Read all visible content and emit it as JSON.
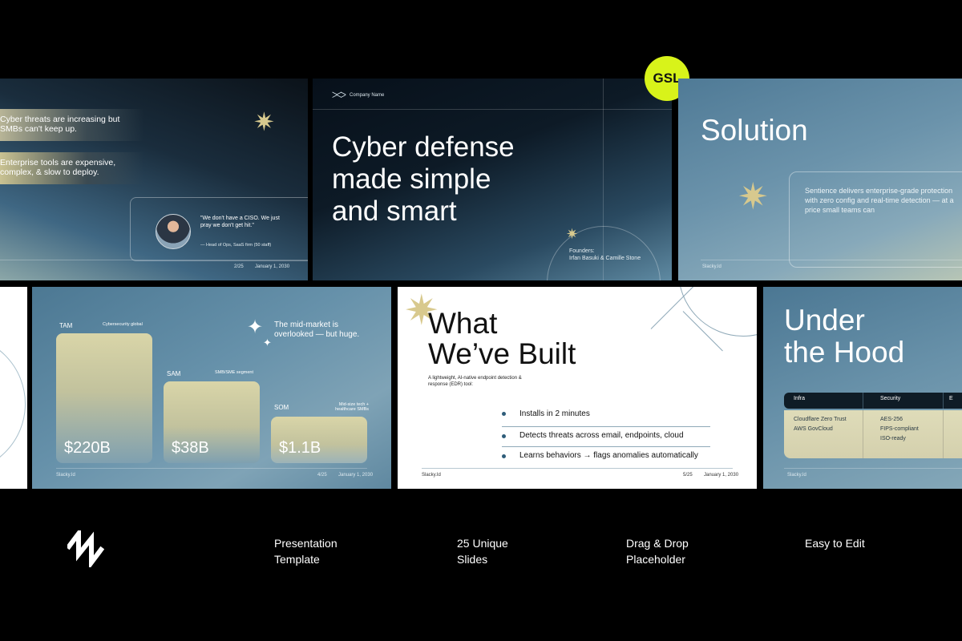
{
  "badge": "GSL",
  "slide1": {
    "problem1": "Cyber threats are increasing but SMBs can't keep up.",
    "problem2": "Enterprise tools are expensive, complex, & slow to deploy.",
    "quote": "\"We don't have a CISO. We just pray we don't get hit.\"",
    "quote_author": "— Head of Ops, SaaS firm (50 staff)",
    "page": "2/25",
    "date": "January 1, 2030"
  },
  "slide2": {
    "company": "Company Name",
    "title_l1": "Cyber defense",
    "title_l2": "made simple",
    "title_l3": "and smart",
    "founders_label": "Founders:",
    "founders": "Irfan Basuki & Camille Stone"
  },
  "slide3": {
    "title": "Solution",
    "body": "Sentience delivers enterprise-grade protection with zero config and real-time detection — at a price small teams can",
    "footer": "Slacky.Id"
  },
  "slide5": {
    "tam_label": "TAM",
    "tam_desc": "Cybersecurity global",
    "tam_value": "$220B",
    "sam_label": "SAM",
    "sam_desc": "SMB/SME segment",
    "sam_value": "$38B",
    "som_label": "SOM",
    "som_desc": "Mid-size tech + healthcare SMBs",
    "som_value": "$1.1B",
    "callout": "The mid-market is overlooked — but huge.",
    "footer": "Slacky.Id",
    "page": "4/25",
    "date": "January 1, 2030"
  },
  "slide6": {
    "title_l1": "What",
    "title_l2": "We’ve Built",
    "subtitle": "A lightweight, AI-native endpoint detection & response (EDR) tool:",
    "bullets": [
      "Installs in 2 minutes",
      "Detects threats across email, endpoints, cloud",
      "Learns behaviors → flags anomalies automatically"
    ],
    "footer": "Slacky.Id",
    "page": "5/25",
    "date": "January 1, 2030"
  },
  "slide7": {
    "title_l1": "Under",
    "title_l2": "the Hood",
    "col_infra": "Infra",
    "col_security": "Security",
    "col_e": "E",
    "infra1": "Cloudflare Zero Trust",
    "infra2": "AWS GovCloud",
    "sec1": "AES-256",
    "sec2": "FIPS-compliant",
    "sec3": "ISO-ready",
    "footer": "Slacky.Id"
  },
  "features": [
    "Presentation Template",
    "25 Unique Slides",
    "Drag & Drop Placeholder",
    "Easy to Edit"
  ],
  "feature_lines": [
    [
      "Presentation",
      "Template"
    ],
    [
      "25 Unique",
      "Slides"
    ],
    [
      "Drag & Drop",
      "Placeholder"
    ],
    [
      "Easy to Edit",
      ""
    ]
  ]
}
